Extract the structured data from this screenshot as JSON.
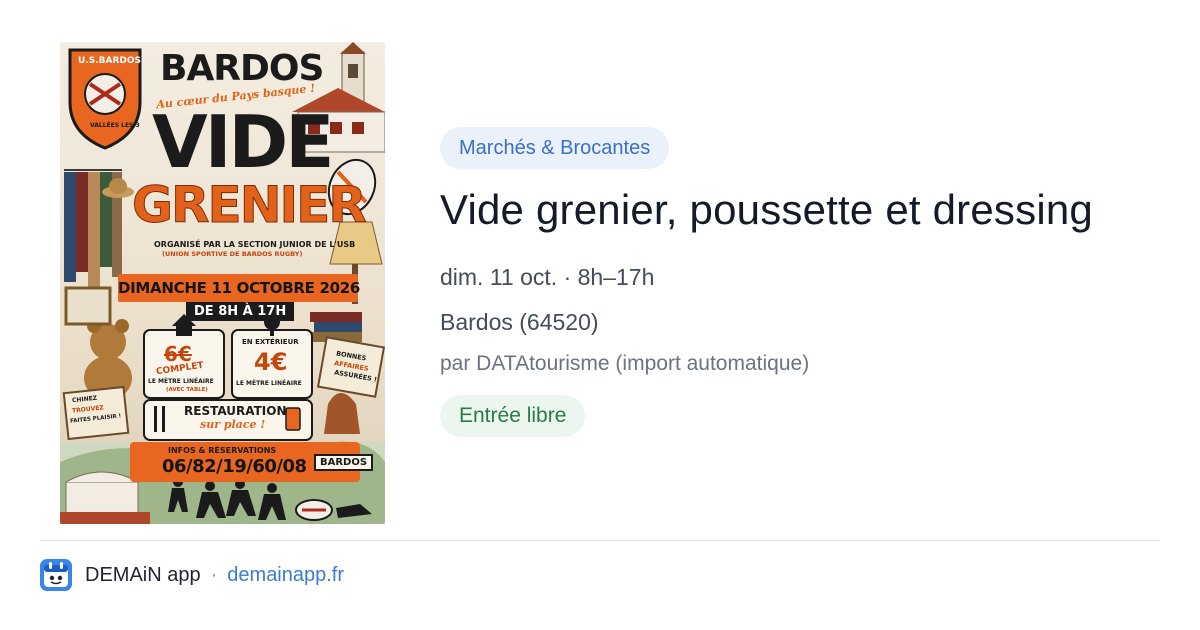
{
  "poster": {
    "club_label": "U.S.BARDOS",
    "club_sub": "VALLÉES LES 3",
    "town": "BARDOS",
    "tagline": "Au cœur du Pays basque !",
    "vide": "VIDE",
    "grenier": "GRENIER",
    "organizer": "ORGANISÉ PAR LA SECTION JUNIOR DE L'USB",
    "organizer_sub": "(UNION SPORTIVE DE BARDOS RUGBY)",
    "date": "DIMANCHE 11 OCTOBRE 2026",
    "hours": "DE 8H À 17H",
    "inside_price": "6€",
    "inside_status": "COMPLET",
    "inside_unit": "LE MÈTRE LINÉAIRE",
    "inside_note": "(AVEC TABLE)",
    "outside_label": "EN EXTÉRIEUR",
    "outside_price": "4€",
    "outside_unit": "LE MÈTRE LINÉAIRE",
    "food": "RESTAURATION",
    "food_sub": "sur place !",
    "infos": "INFOS & RÉSERVATIONS",
    "phone": "06/82/19/60/08",
    "sign": "BARDOS",
    "left_sign": [
      "CHINEZ",
      "TROUVEZ",
      "FAITES PLAISIR !"
    ],
    "right_sign": [
      "BONNES",
      "AFFAIRES",
      "ASSURÉES !"
    ]
  },
  "event": {
    "category": "Marchés & Brocantes",
    "title": "Vide grenier, poussette et dressing",
    "when": "dim. 11 oct. · 8h–17h",
    "where": "Bardos (64520)",
    "source": "par DATAtourisme (import automatique)",
    "price": "Entrée libre"
  },
  "footer": {
    "app_name": "DEMAiN app",
    "separator": "·",
    "link": "demainapp.fr"
  },
  "colors": {
    "category_bg": "#eaf1fb",
    "category_text": "#3b6fc4",
    "price_bg": "#eaf6ee",
    "price_text": "#2c7a44",
    "link": "#3b7bd4",
    "poster_orange": "#e8661f"
  }
}
